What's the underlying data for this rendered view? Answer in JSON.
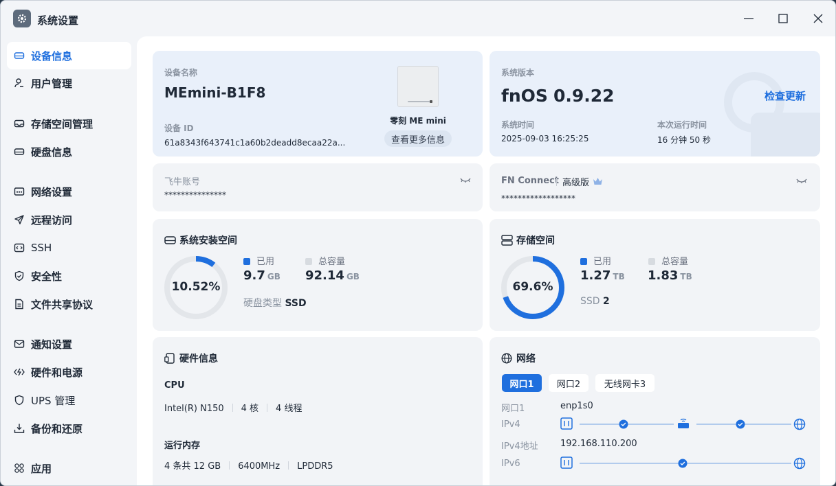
{
  "app": {
    "title": "系统设置"
  },
  "sidebar": {
    "items": [
      {
        "label": "设备信息"
      },
      {
        "label": "用户管理"
      },
      {
        "label": "存储空间管理"
      },
      {
        "label": "硬盘信息"
      },
      {
        "label": "网络设置"
      },
      {
        "label": "远程访问"
      },
      {
        "label": "SSH"
      },
      {
        "label": "安全性"
      },
      {
        "label": "文件共享协议"
      },
      {
        "label": "通知设置"
      },
      {
        "label": "硬件和电源"
      },
      {
        "label": "UPS 管理"
      },
      {
        "label": "备份和还原"
      },
      {
        "label": "应用"
      }
    ]
  },
  "device": {
    "name_label": "设备名称",
    "name": "MEmini-B1F8",
    "id_label": "设备 ID",
    "id": "61a8343f643741c1a60b2deadd8ecaa22a...",
    "model": "零刻 ME mini",
    "more_info": "查看更多信息"
  },
  "system": {
    "version_label": "系统版本",
    "os": "fnOS",
    "version": "0.9.22",
    "check_update": "检查更新",
    "time_label": "系统时间",
    "time": "2025-09-03 16:25:25",
    "uptime_label": "本次运行时间",
    "uptime": "16 分钟 50 秒"
  },
  "account": {
    "label": "飞牛账号",
    "value": "***************"
  },
  "connect": {
    "label": "FN Connect",
    "tier": "高级版",
    "value": "******************"
  },
  "sys_space": {
    "title": "系统安装空间",
    "percent_label": "10.52%",
    "percent": 0.1052,
    "used_label": "已用",
    "used": "9.7",
    "used_unit": "GB",
    "total_label": "总容量",
    "total": "92.14",
    "total_unit": "GB",
    "disk_type_label": "硬盘类型",
    "disk_type": "SSD"
  },
  "storage": {
    "title": "存储空间",
    "percent_label": "69.6%",
    "percent": 0.696,
    "used_label": "已用",
    "used": "1.27",
    "used_unit": "TB",
    "total_label": "总容量",
    "total": "1.83",
    "total_unit": "TB",
    "ssd_label": "SSD",
    "ssd_count": "2"
  },
  "hardware": {
    "title": "硬件信息",
    "cpu_label": "CPU",
    "cpu_model": "Intel(R) N150",
    "cores": "4 核",
    "threads": "4 线程",
    "mem_label": "运行内存",
    "mem_size": "4 条共 12 GB",
    "mem_speed": "6400MHz",
    "mem_type": "LPDDR5"
  },
  "network": {
    "title": "网络",
    "tabs": [
      "网口1",
      "网口2",
      "无线网卡3"
    ],
    "iface_label": "网口1",
    "iface": "enp1s0",
    "ipv4_label": "IPv4",
    "ipv4_addr_label": "IPv4地址",
    "ipv4_addr": "192.168.110.200",
    "ipv6_label": "IPv6"
  },
  "colors": {
    "accent": "#1f6fde",
    "ring_track": "#e3e6ea"
  }
}
